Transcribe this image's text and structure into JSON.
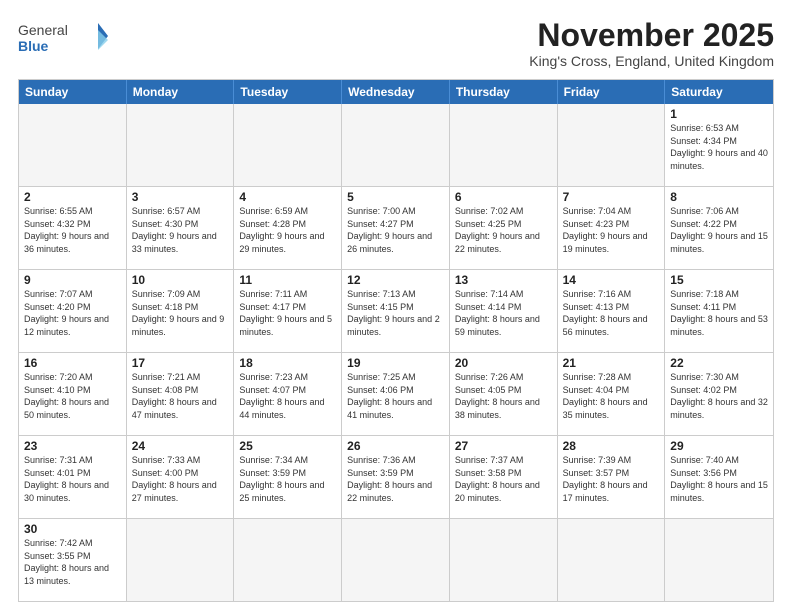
{
  "header": {
    "logo_general": "General",
    "logo_blue": "Blue",
    "month_title": "November 2025",
    "location": "King's Cross, England, United Kingdom"
  },
  "days_of_week": [
    "Sunday",
    "Monday",
    "Tuesday",
    "Wednesday",
    "Thursday",
    "Friday",
    "Saturday"
  ],
  "weeks": [
    [
      {
        "day": "",
        "empty": true
      },
      {
        "day": "",
        "empty": true
      },
      {
        "day": "",
        "empty": true
      },
      {
        "day": "",
        "empty": true
      },
      {
        "day": "",
        "empty": true
      },
      {
        "day": "",
        "empty": true
      },
      {
        "day": "1",
        "sunrise": "6:53 AM",
        "sunset": "4:34 PM",
        "daylight": "9 hours and 40 minutes."
      }
    ],
    [
      {
        "day": "2",
        "sunrise": "6:55 AM",
        "sunset": "4:32 PM",
        "daylight": "9 hours and 36 minutes."
      },
      {
        "day": "3",
        "sunrise": "6:57 AM",
        "sunset": "4:30 PM",
        "daylight": "9 hours and 33 minutes."
      },
      {
        "day": "4",
        "sunrise": "6:59 AM",
        "sunset": "4:28 PM",
        "daylight": "9 hours and 29 minutes."
      },
      {
        "day": "5",
        "sunrise": "7:00 AM",
        "sunset": "4:27 PM",
        "daylight": "9 hours and 26 minutes."
      },
      {
        "day": "6",
        "sunrise": "7:02 AM",
        "sunset": "4:25 PM",
        "daylight": "9 hours and 22 minutes."
      },
      {
        "day": "7",
        "sunrise": "7:04 AM",
        "sunset": "4:23 PM",
        "daylight": "9 hours and 19 minutes."
      },
      {
        "day": "8",
        "sunrise": "7:06 AM",
        "sunset": "4:22 PM",
        "daylight": "9 hours and 15 minutes."
      }
    ],
    [
      {
        "day": "9",
        "sunrise": "7:07 AM",
        "sunset": "4:20 PM",
        "daylight": "9 hours and 12 minutes."
      },
      {
        "day": "10",
        "sunrise": "7:09 AM",
        "sunset": "4:18 PM",
        "daylight": "9 hours and 9 minutes."
      },
      {
        "day": "11",
        "sunrise": "7:11 AM",
        "sunset": "4:17 PM",
        "daylight": "9 hours and 5 minutes."
      },
      {
        "day": "12",
        "sunrise": "7:13 AM",
        "sunset": "4:15 PM",
        "daylight": "9 hours and 2 minutes."
      },
      {
        "day": "13",
        "sunrise": "7:14 AM",
        "sunset": "4:14 PM",
        "daylight": "8 hours and 59 minutes."
      },
      {
        "day": "14",
        "sunrise": "7:16 AM",
        "sunset": "4:13 PM",
        "daylight": "8 hours and 56 minutes."
      },
      {
        "day": "15",
        "sunrise": "7:18 AM",
        "sunset": "4:11 PM",
        "daylight": "8 hours and 53 minutes."
      }
    ],
    [
      {
        "day": "16",
        "sunrise": "7:20 AM",
        "sunset": "4:10 PM",
        "daylight": "8 hours and 50 minutes."
      },
      {
        "day": "17",
        "sunrise": "7:21 AM",
        "sunset": "4:08 PM",
        "daylight": "8 hours and 47 minutes."
      },
      {
        "day": "18",
        "sunrise": "7:23 AM",
        "sunset": "4:07 PM",
        "daylight": "8 hours and 44 minutes."
      },
      {
        "day": "19",
        "sunrise": "7:25 AM",
        "sunset": "4:06 PM",
        "daylight": "8 hours and 41 minutes."
      },
      {
        "day": "20",
        "sunrise": "7:26 AM",
        "sunset": "4:05 PM",
        "daylight": "8 hours and 38 minutes."
      },
      {
        "day": "21",
        "sunrise": "7:28 AM",
        "sunset": "4:04 PM",
        "daylight": "8 hours and 35 minutes."
      },
      {
        "day": "22",
        "sunrise": "7:30 AM",
        "sunset": "4:02 PM",
        "daylight": "8 hours and 32 minutes."
      }
    ],
    [
      {
        "day": "23",
        "sunrise": "7:31 AM",
        "sunset": "4:01 PM",
        "daylight": "8 hours and 30 minutes."
      },
      {
        "day": "24",
        "sunrise": "7:33 AM",
        "sunset": "4:00 PM",
        "daylight": "8 hours and 27 minutes."
      },
      {
        "day": "25",
        "sunrise": "7:34 AM",
        "sunset": "3:59 PM",
        "daylight": "8 hours and 25 minutes."
      },
      {
        "day": "26",
        "sunrise": "7:36 AM",
        "sunset": "3:59 PM",
        "daylight": "8 hours and 22 minutes."
      },
      {
        "day": "27",
        "sunrise": "7:37 AM",
        "sunset": "3:58 PM",
        "daylight": "8 hours and 20 minutes."
      },
      {
        "day": "28",
        "sunrise": "7:39 AM",
        "sunset": "3:57 PM",
        "daylight": "8 hours and 17 minutes."
      },
      {
        "day": "29",
        "sunrise": "7:40 AM",
        "sunset": "3:56 PM",
        "daylight": "8 hours and 15 minutes."
      }
    ],
    [
      {
        "day": "30",
        "sunrise": "7:42 AM",
        "sunset": "3:55 PM",
        "daylight": "8 hours and 13 minutes."
      },
      {
        "day": "",
        "empty": true
      },
      {
        "day": "",
        "empty": true
      },
      {
        "day": "",
        "empty": true
      },
      {
        "day": "",
        "empty": true
      },
      {
        "day": "",
        "empty": true
      },
      {
        "day": "",
        "empty": true
      }
    ]
  ]
}
